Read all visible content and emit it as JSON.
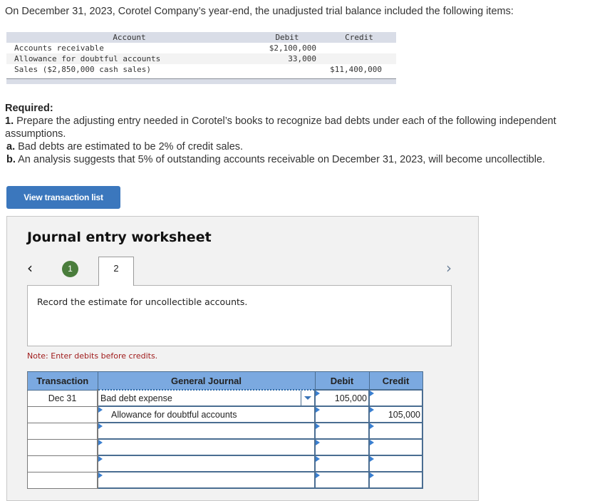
{
  "intro": "On December 31, 2023, Corotel Company’s year-end, the unadjusted trial balance included the following items:",
  "trial_balance": {
    "headers": {
      "account": "Account",
      "debit": "Debit",
      "credit": "Credit"
    },
    "rows": [
      {
        "account": "Accounts receivable",
        "debit": "$2,100,000",
        "credit": ""
      },
      {
        "account": "Allowance for doubtful accounts",
        "debit": "33,000",
        "credit": ""
      },
      {
        "account": "Sales ($2,850,000 cash sales)",
        "debit": "",
        "credit": "$11,400,000"
      }
    ]
  },
  "required": {
    "heading": "Required:",
    "item1_num": "1.",
    "item1_text": " Prepare the adjusting entry needed in Corotel’s books to recognize bad debts under each of the following independent",
    "item1_cont": "assumptions.",
    "a_label": "a.",
    "a_text": " Bad debts are estimated to be 2% of credit sales.",
    "b_label": "b.",
    "b_text": " An analysis suggests that 5% of outstanding accounts receivable on December 31, 2023, will become uncollectible."
  },
  "buttons": {
    "view_transaction_list": "View transaction list"
  },
  "worksheet": {
    "title": "Journal entry worksheet",
    "nav_prev": "‹",
    "nav_next": "›",
    "steps": [
      {
        "label": "1",
        "status": "completed"
      },
      {
        "label": "2",
        "status": "active"
      }
    ],
    "description": "Record the estimate for uncollectible accounts.",
    "note": "Note: Enter debits before credits.",
    "table": {
      "headers": {
        "transaction": "Transaction",
        "general_journal": "General Journal",
        "debit": "Debit",
        "credit": "Credit"
      },
      "rows": [
        {
          "transaction": "Dec 31",
          "account": "Bad debt expense",
          "debit": "105,000",
          "credit": ""
        },
        {
          "transaction": "",
          "account": "Allowance for doubtful accounts",
          "debit": "",
          "credit": "105,000"
        },
        {
          "transaction": "",
          "account": "",
          "debit": "",
          "credit": ""
        },
        {
          "transaction": "",
          "account": "",
          "debit": "",
          "credit": ""
        },
        {
          "transaction": "",
          "account": "",
          "debit": "",
          "credit": ""
        },
        {
          "transaction": "",
          "account": "",
          "debit": "",
          "credit": ""
        }
      ]
    }
  },
  "colors": {
    "button_bg": "#3b77bd",
    "step_complete": "#4a7d3c",
    "table_header": "#7ba9e0",
    "note_text": "#a01c1c"
  }
}
